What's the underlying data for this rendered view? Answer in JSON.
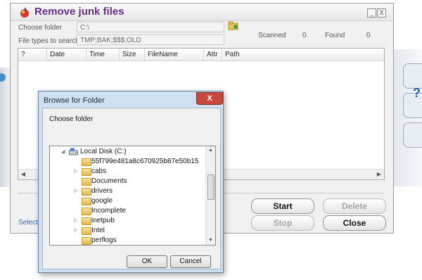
{
  "window": {
    "title": "Remove junk files",
    "minimize_glyph": "_",
    "close_glyph": "X",
    "icon": "app-icon"
  },
  "form": {
    "choose_folder_label": "Choose folder",
    "choose_folder_value": "C:\\",
    "file_types_label": "File types to search",
    "file_types_value": "TMP;BAK;$$$;OLD"
  },
  "stats": {
    "scanned_label": "Scanned",
    "scanned_value": "0",
    "found_label": "Found",
    "found_value": "0"
  },
  "table": {
    "columns": [
      "?",
      "Date",
      "Time",
      "Size",
      "FileName",
      "Attr",
      "Path"
    ]
  },
  "link_text": "Select f",
  "buttons": {
    "start": "Start",
    "delete": "Delete",
    "stop": "Stop",
    "close": "Close"
  },
  "dialog": {
    "title": "Browse for Folder",
    "close_glyph": "X",
    "message": "Choose folder",
    "root": "Local Disk (C:)",
    "items": [
      "55f799e481a8c670925b87e50b15",
      "cabs",
      "Documents",
      "drivers",
      "google",
      "Incomplete",
      "inetpub",
      "Intel",
      "perflogs"
    ],
    "ok": "OK",
    "cancel": "Cancel"
  },
  "colors": {
    "title": "#6b2c86",
    "link": "#2b62c2",
    "dialog_frame": "#cfe0f2",
    "close_red": "#c94a3c"
  }
}
